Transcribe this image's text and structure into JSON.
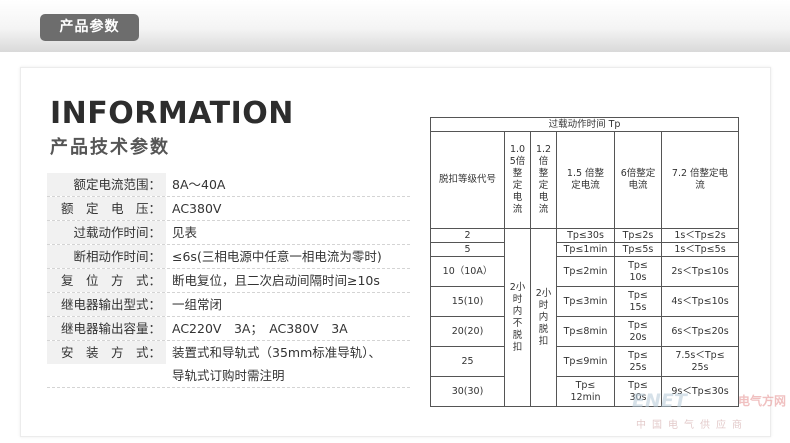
{
  "header": {
    "tab_label": "产品参数"
  },
  "heading": {
    "english": "INFORMATION",
    "chinese": "产品技术参数"
  },
  "params": [
    {
      "label": "额定电流范围：",
      "value": "8A～40A"
    },
    {
      "label": "额　定　电　压：",
      "value": "AC380V"
    },
    {
      "label": "过载动作时间：",
      "value": "见表"
    },
    {
      "label": "断相动作时间：",
      "value": "≤6s(三相电源中任意一相电流为零时)"
    },
    {
      "label": "复　位　方　式：",
      "value": "断电复位，且二次启动间隔时间≥10s"
    },
    {
      "label": "继电器输出型式：",
      "value": "一组常闭"
    },
    {
      "label": "继电器输出容量：",
      "value": "AC220V　3A；　AC380V　3A"
    },
    {
      "label": "安　装　方　式：",
      "value": "装置式和导轨式（35mm标准导轨）、",
      "value2": "导轨式订购时需注明"
    }
  ],
  "table": {
    "title": "过载动作时间 Tp",
    "headers": {
      "grade": "脱扣等级代号",
      "c105": "1.0\n5倍\n整\n定\n电\n流",
      "c12": "1.2\n倍\n整\n定\n电\n流",
      "c15": "1.5 倍整\n定电流",
      "c6": "6倍整定\n电流",
      "c72": "7.2 倍整定电\n流"
    },
    "c105_merged": "2小\n时\n内\n不\n脱\n扣",
    "c12_merged": "2小\n时\n内\n脱\n扣",
    "rows": [
      {
        "grade": "2",
        "c15": "Tp≤30s",
        "c6": "Tp≤2s",
        "c72": "1s＜Tp≤2s"
      },
      {
        "grade": "5",
        "c15": "Tp≤1min",
        "c6": "Tp≤5s",
        "c72": "1s＜Tp≤5s"
      },
      {
        "grade": "10（10A）",
        "c15": "Tp≤2min",
        "c6": "Tp≤\n10s",
        "c72": "2s＜Tp≤10s"
      },
      {
        "grade": "15(10)",
        "c15": "Tp≤3min",
        "c6": "Tp≤\n15s",
        "c72": "4s＜Tp≤10s"
      },
      {
        "grade": "20(20)",
        "c15": "Tp≤8min",
        "c6": "Tp≤\n20s",
        "c72": "6s＜Tp≤20s"
      },
      {
        "grade": "25",
        "c15": "Tp≤9min",
        "c6": "Tp≤\n25s",
        "c72": "7.5s＜Tp≤\n25s"
      },
      {
        "grade": "30(30)",
        "c15": "Tp≤\n12min",
        "c6": "Tp≤\n30s",
        "c72": "9s＜Tp≤30s"
      }
    ]
  },
  "watermark": {
    "line1": "电气方网",
    "line2": "ENET",
    "line3": "中国电气供应商"
  }
}
